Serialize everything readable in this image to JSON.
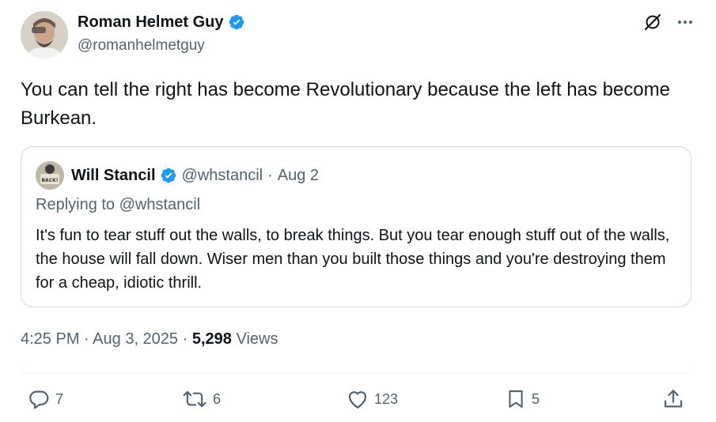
{
  "author": {
    "name": "Roman Helmet Guy",
    "handle": "@romanhelmetguy"
  },
  "tweet": {
    "text": "You can tell the right has become Revolutionary because the left has become Burkean."
  },
  "quoted": {
    "name": "Will Stancil",
    "handle": "@whstancil",
    "separator": "·",
    "date": "Aug 2",
    "replying": "Replying to @whstancil",
    "text": "It's fun to tear stuff out the walls, to break things. But you tear enough stuff out of the walls, the house will fall down. Wiser men than you built those things and you're destroying them for a cheap, idiotic thrill.",
    "avatar_sign_text": "BACK!"
  },
  "meta": {
    "time": "4:25 PM",
    "date": "Aug 3, 2025",
    "separator": "·",
    "views_count": "5,298",
    "views_label": "Views"
  },
  "actions": {
    "replies": "7",
    "reposts": "6",
    "likes": "123",
    "bookmarks": "5"
  },
  "colors": {
    "verified": "#1d9bf0",
    "secondary_text": "#536471",
    "primary_text": "#0f1419",
    "border": "#cfd9de"
  },
  "icons": [
    "verified-badge-icon",
    "grok-icon",
    "more-icon",
    "reply-icon",
    "repost-icon",
    "like-icon",
    "bookmark-icon",
    "share-icon"
  ]
}
